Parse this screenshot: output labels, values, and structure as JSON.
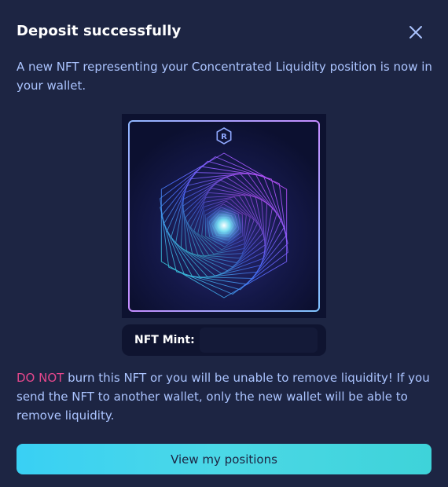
{
  "dialog": {
    "title": "Deposit successfully",
    "close_icon": "close-icon",
    "description": "A new NFT representing your Concentrated Liquidity position is now in your wallet."
  },
  "nft": {
    "logo_icon": "raydium-logo-icon",
    "mint_label": "NFT Mint:",
    "mint_value": ""
  },
  "warning": {
    "highlight": "DO NOT",
    "text": " burn this NFT or you will be unable to remove liquidity! If you send the NFT to another wallet, only the new wallet will be able to remove liquidity."
  },
  "actions": {
    "view_positions_label": "View my positions"
  },
  "colors": {
    "background": "#1d2543",
    "text": "#abc4ff",
    "danger": "#e5478c",
    "accent": "#39d0f4"
  }
}
